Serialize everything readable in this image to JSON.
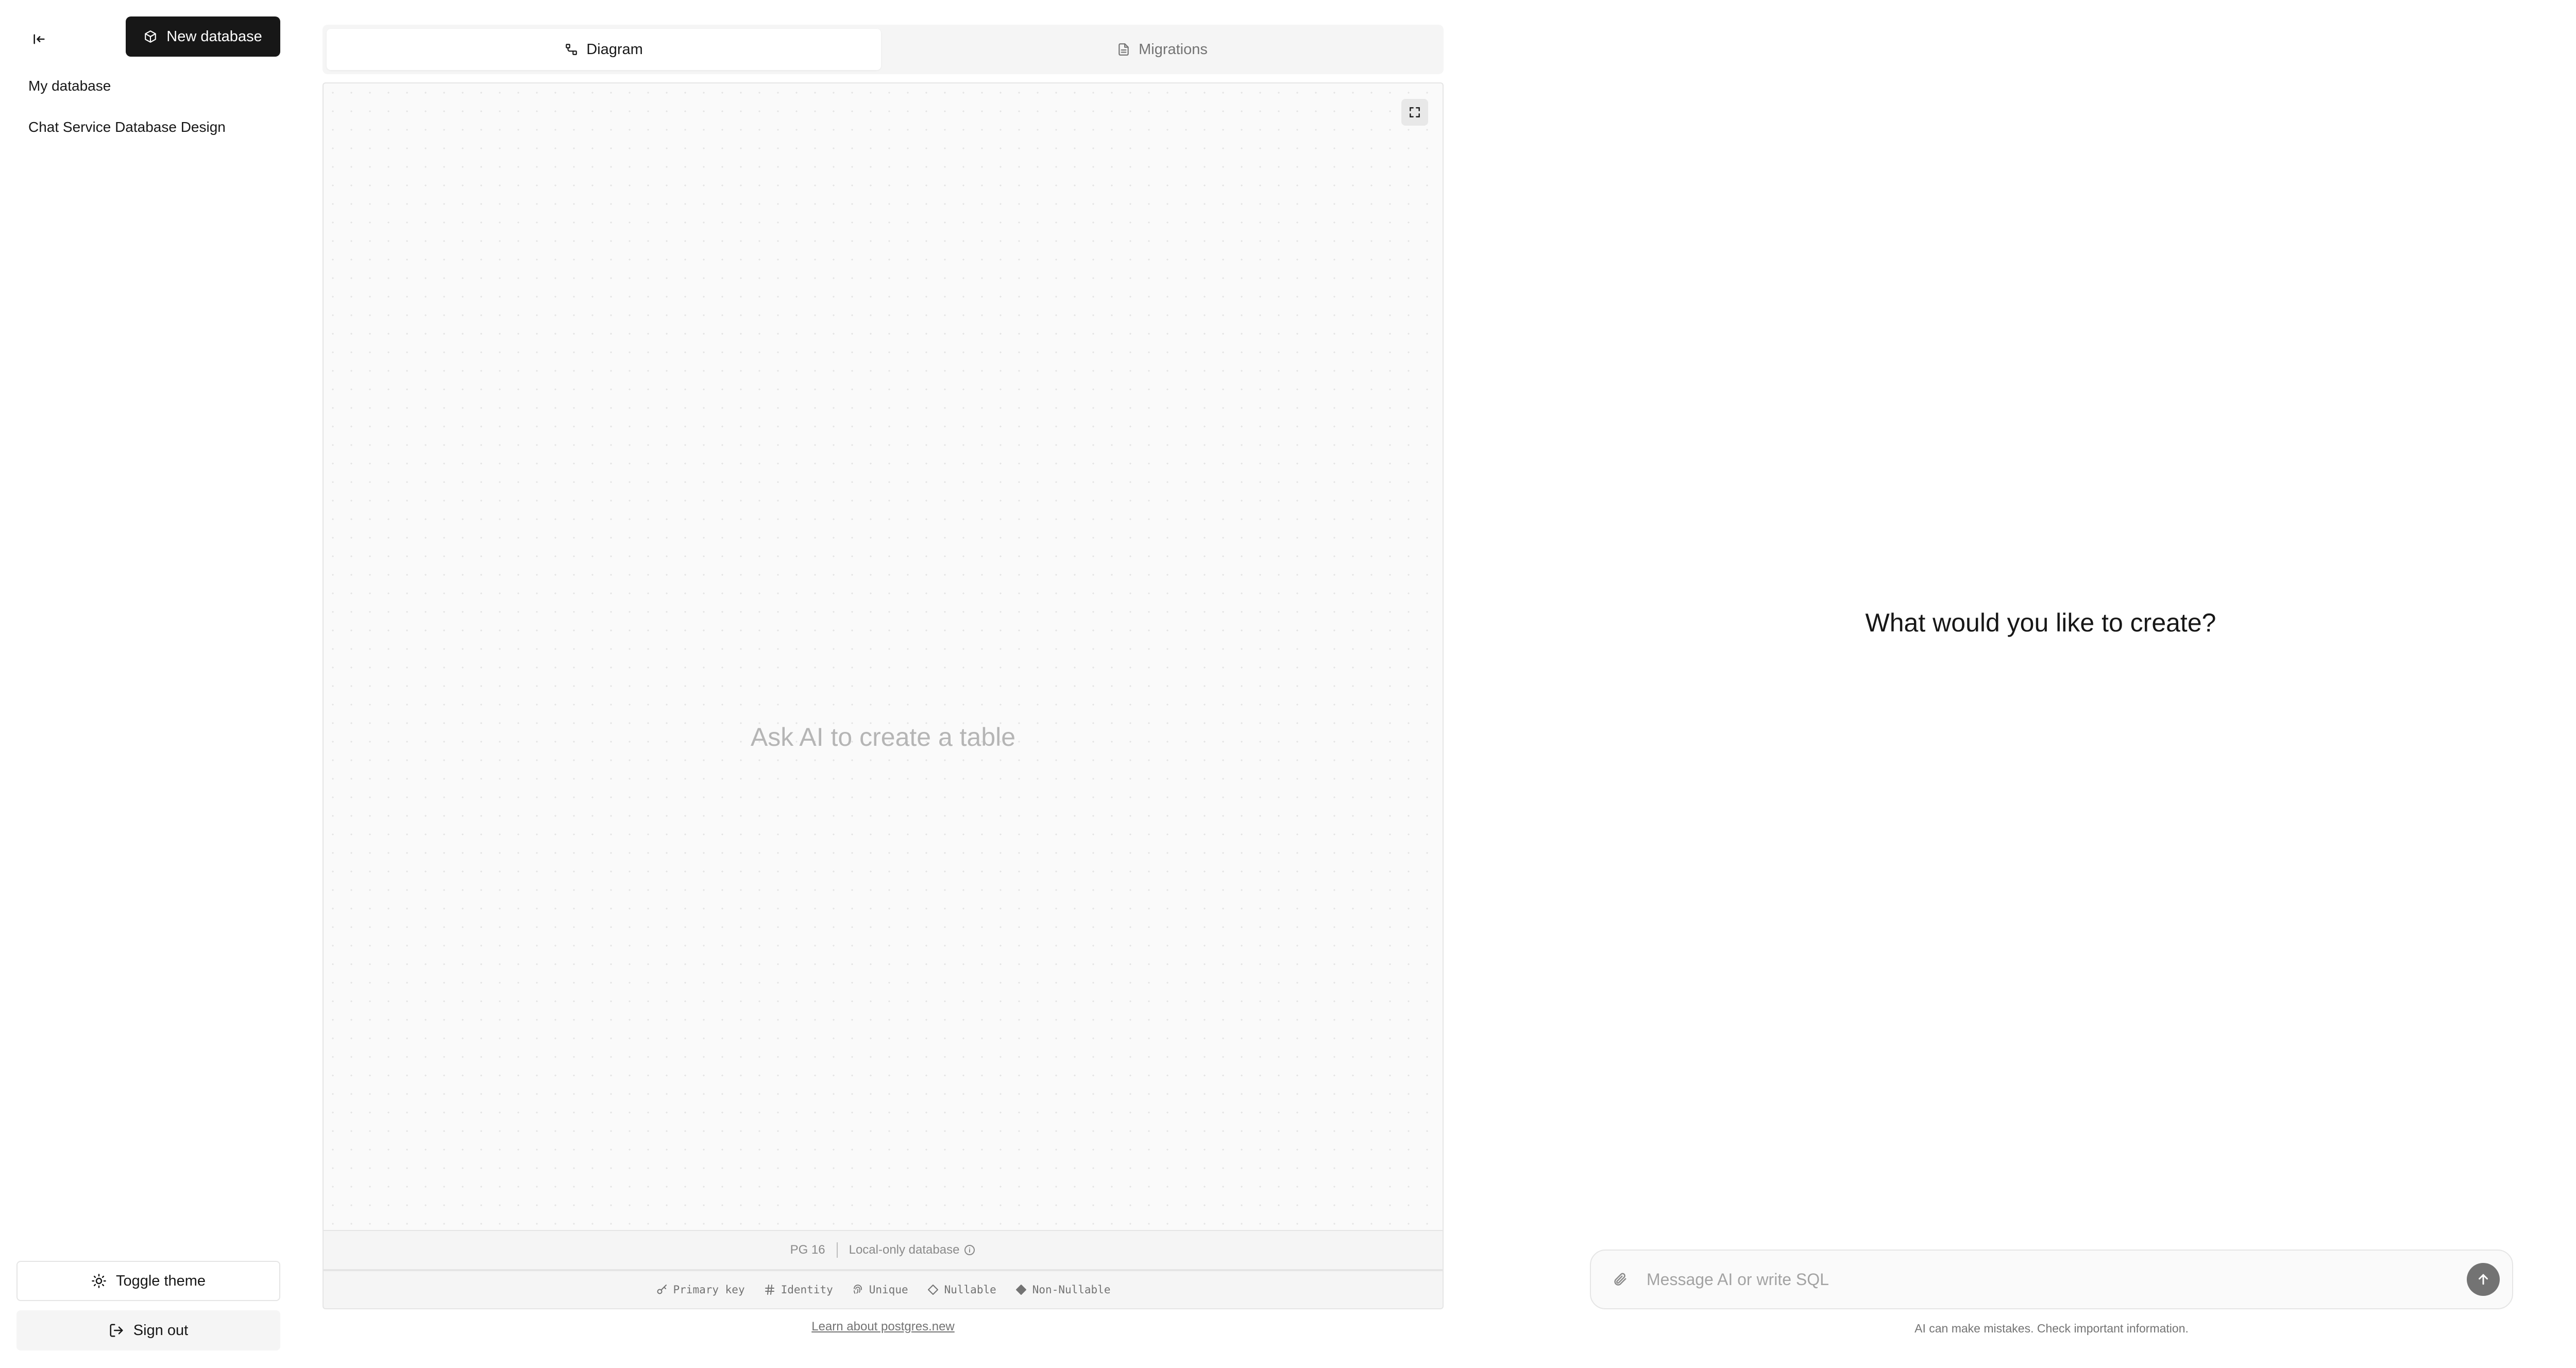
{
  "sidebar": {
    "new_database_label": "New database",
    "databases": [
      {
        "label": "My database"
      },
      {
        "label": "Chat Service Database Design"
      }
    ],
    "toggle_theme_label": "Toggle theme",
    "sign_out_label": "Sign out"
  },
  "tabs": [
    {
      "label": "Diagram",
      "icon": "diagram-icon",
      "active": true
    },
    {
      "label": "Migrations",
      "icon": "file-icon",
      "active": false
    }
  ],
  "canvas": {
    "empty_hint": "Ask AI to create a table"
  },
  "status": {
    "version": "PG 16",
    "mode": "Local-only database"
  },
  "legend": [
    {
      "label": "Primary key",
      "icon": "key-icon"
    },
    {
      "label": "Identity",
      "icon": "hash-icon"
    },
    {
      "label": "Unique",
      "icon": "fingerprint-icon"
    },
    {
      "label": "Nullable",
      "icon": "diamond-outline-icon"
    },
    {
      "label": "Non-Nullable",
      "icon": "diamond-filled-icon"
    }
  ],
  "learn_link": "Learn about postgres.new",
  "chat": {
    "heading": "What would you like to create?",
    "input_placeholder": "Message AI or write SQL",
    "input_value": "",
    "disclaimer": "AI can make mistakes. Check important information."
  },
  "colors": {
    "primary_button_bg": "#171717",
    "canvas_bg": "#fafafa",
    "send_button_bg": "#737373"
  }
}
